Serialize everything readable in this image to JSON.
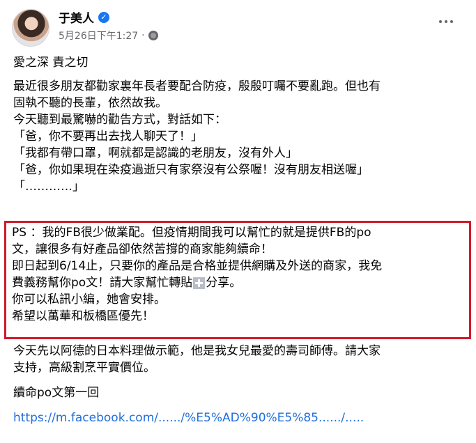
{
  "post": {
    "author": "于美人",
    "verified_icon": "verified-check-icon",
    "timestamp": "5月26日下午1:27",
    "separator": "·",
    "audience_icon": "globe-icon",
    "more_icon": "more-options-icon"
  },
  "content": {
    "heading": "愛之深 責之切",
    "paragraph1": [
      "最近很多朋友都勸家裏年長者要配合防疫，殷殷叮囑不要亂跑。但也有",
      "固執不聽的長輩，依然故我。",
      "今天聽到最驚嚇的勸告方式，對話如下：",
      "「爸，你不要再出去找人聊天了！」",
      "「我都有帶口罩，啊就都是認識的老朋友，沒有外人」",
      "「爸，你如果現在染疫過逝只有家祭沒有公祭喔！沒有朋友相送喔」",
      "「…………」"
    ],
    "highlight": {
      "lines": [
        "PS ：我的FB很少做業配。但疫情期間我可以幫忙的就是提供FB的po",
        "文，讓很多有好產品卻依然苦撐的商家能夠續命！",
        "即日起到6/14止，只要你的產品是合格並提供網購及外送的商家，我免"
      ],
      "line4_before": "費義務幫你po文！請大家幫忙轉貼",
      "line4_after": "分享。",
      "plus_icon": "heavy-plus-icon",
      "lines_end": [
        "你可以私訊小編，她會安排。",
        "希望以萬華和板橋區優先！"
      ]
    },
    "paragraph2": [
      "今天先以阿德的日本料理做示範，他是我女兒最愛的壽司師傅。請大家",
      "支持，高級割烹平實價位。"
    ],
    "series_title": "續命po文第一回",
    "link_text": "https://m.facebook.com/....../%E5%AD%90%E5%85....../....."
  },
  "colors": {
    "highlight_border": "#d11a2a",
    "link": "#216fdb",
    "meta_text": "#65676b",
    "verified": "#1877f2"
  }
}
